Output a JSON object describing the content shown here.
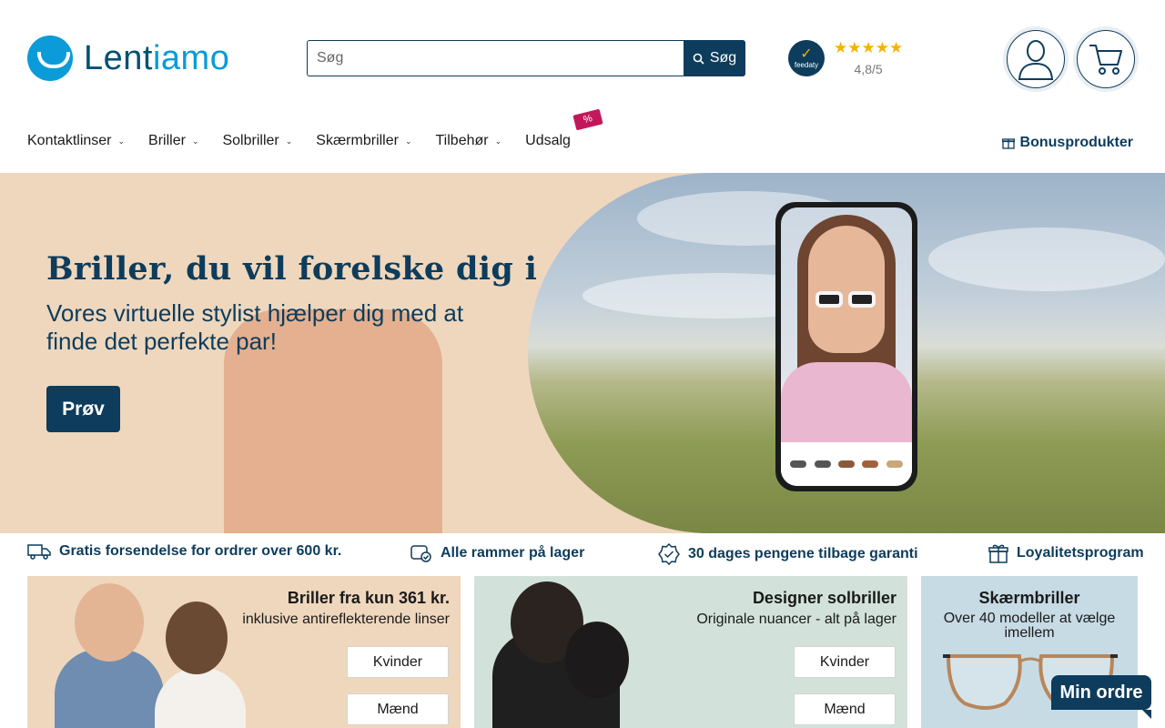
{
  "header": {
    "logo_text_1": "Lent",
    "logo_text_2": "iamo",
    "search_placeholder": "Søg",
    "search_button": "Søg",
    "feedaty_label": "feedaty",
    "rating_stars": "★★★★★",
    "rating_text": "4,8/5"
  },
  "nav": {
    "items": [
      {
        "label": "Kontaktlinser"
      },
      {
        "label": "Briller"
      },
      {
        "label": "Solbriller"
      },
      {
        "label": "Skærmbriller"
      },
      {
        "label": "Tilbehør"
      },
      {
        "label": "Udsalg"
      }
    ],
    "sale_badge": "%",
    "bonus_label": "Bonusprodukter"
  },
  "hero": {
    "title": "Briller, du vil forelske dig i",
    "subtitle": "Vores virtuelle stylist hjælper dig med at finde det perfekte par!",
    "cta": "Prøv"
  },
  "usps": [
    {
      "label": "Gratis forsendelse for ordrer over 600 kr."
    },
    {
      "label": "Alle rammer på lager"
    },
    {
      "label": "30 dages pengene tilbage garanti"
    },
    {
      "label": "Loyalitetsprogram"
    }
  ],
  "cards": [
    {
      "title": "Briller fra kun 361 kr.",
      "subtitle": "inklusive antireflekterende linser",
      "btn_women": "Kvinder",
      "btn_men": "Mænd",
      "bg": "#efd7bd"
    },
    {
      "title": "Designer solbriller",
      "subtitle": "Originale nuancer - alt på lager",
      "btn_women": "Kvinder",
      "btn_men": "Mænd",
      "bg": "#d2e2da"
    },
    {
      "title": "Skærmbriller",
      "subtitle": "Over 40 modeller at vælge imellem",
      "bg": "#c7dbe5"
    }
  ],
  "floating": {
    "min_ordre": "Min ordre"
  },
  "colors": {
    "primary": "#0d3c5c",
    "logo_blue": "#0a9bd8",
    "star": "#f3b300",
    "sale": "#c2185b"
  }
}
